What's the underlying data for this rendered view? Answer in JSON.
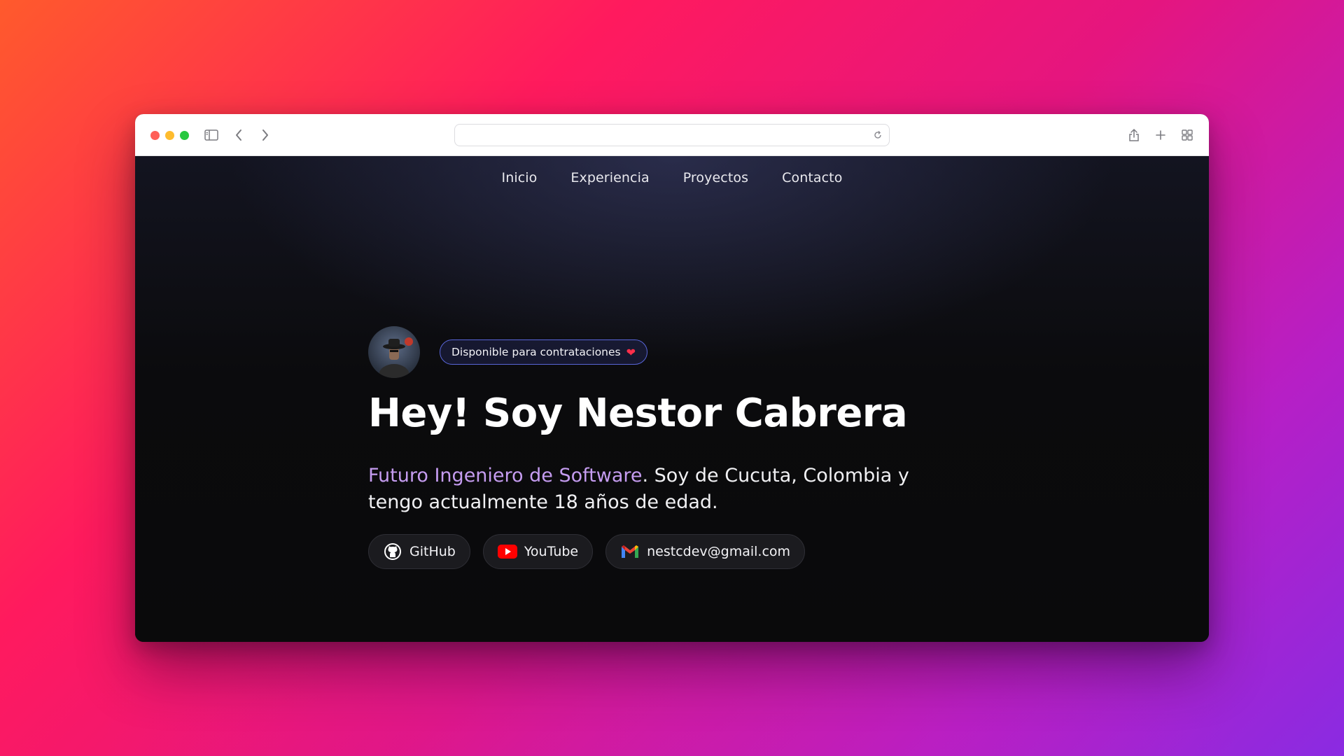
{
  "nav": {
    "items": [
      {
        "label": "Inicio"
      },
      {
        "label": "Experiencia"
      },
      {
        "label": "Proyectos"
      },
      {
        "label": "Contacto"
      }
    ]
  },
  "hero": {
    "availability": "Disponible para contrataciones",
    "title": "Hey! Soy Nestor Cabrera",
    "intro_highlight": "Futuro Ingeniero de Software",
    "intro_rest": ". Soy de Cucuta, Colombia y tengo actualmente 18 años de edad."
  },
  "links": [
    {
      "label": "GitHub",
      "icon": "github-icon"
    },
    {
      "label": "YouTube",
      "icon": "youtube-icon"
    },
    {
      "label": "nestcdev@gmail.com",
      "icon": "gmail-icon"
    }
  ],
  "browser": {
    "address": ""
  },
  "colors": {
    "accent": "#c59cf0",
    "badge_border": "#5865d8",
    "heart": "#ff2f4a"
  }
}
